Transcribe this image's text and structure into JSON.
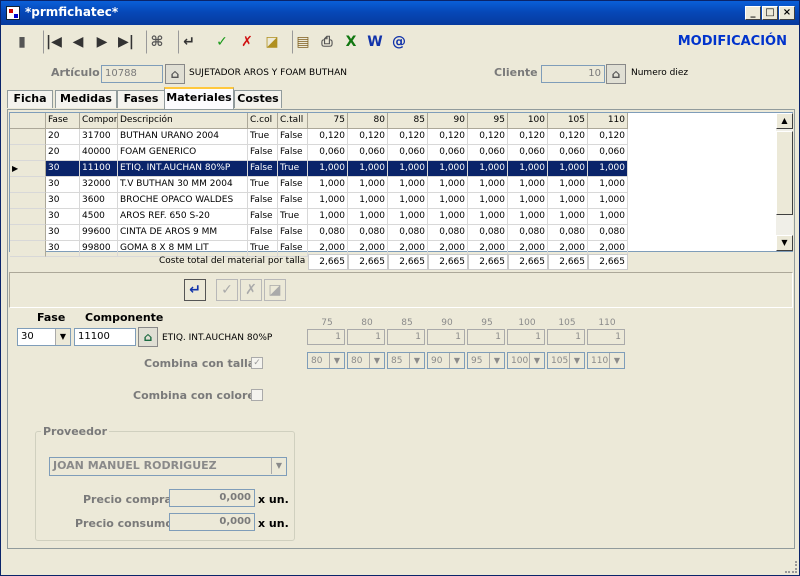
{
  "window": {
    "title": "*prmfichatec*"
  },
  "mode": "MODIFICACIÓN",
  "toolbar": {
    "icons": [
      "exit-icon",
      "first-icon",
      "prev-icon",
      "next-icon",
      "last-icon",
      "search-icon",
      "enter-icon",
      "accept-icon",
      "cancel-icon",
      "eraser-icon",
      "copy-icon",
      "print-icon",
      "excel-icon",
      "word-icon",
      "email-icon"
    ]
  },
  "header": {
    "articulo_label": "Artículo",
    "articulo_value": "10788",
    "articulo_desc": "SUJETADOR AROS Y FOAM BUTHAN",
    "cliente_label": "Cliente",
    "cliente_value": "10",
    "cliente_desc": "Numero diez"
  },
  "tabs": [
    "Ficha",
    "Medidas",
    "Fases",
    "Materiales",
    "Costes"
  ],
  "active_tab": "Materiales",
  "grid": {
    "columns": [
      "",
      "Fase",
      "Compon",
      "Descripción",
      "C.col",
      "C.tall",
      "75",
      "80",
      "85",
      "90",
      "95",
      "100",
      "105",
      "110"
    ],
    "rows": [
      {
        "sel": false,
        "fase": "20",
        "comp": "31700",
        "desc": "BUTHAN URANO 2004",
        "ccol": "True",
        "ctall": "False",
        "vals": [
          "0,120",
          "0,120",
          "0,120",
          "0,120",
          "0,120",
          "0,120",
          "0,120",
          "0,120"
        ]
      },
      {
        "sel": false,
        "fase": "20",
        "comp": "40000",
        "desc": "FOAM GENERICO",
        "ccol": "False",
        "ctall": "False",
        "vals": [
          "0,060",
          "0,060",
          "0,060",
          "0,060",
          "0,060",
          "0,060",
          "0,060",
          "0,060"
        ]
      },
      {
        "sel": true,
        "fase": "30",
        "comp": "11100",
        "desc": "ETIQ. INT.AUCHAN 80%P",
        "ccol": "False",
        "ctall": "True",
        "vals": [
          "1,000",
          "1,000",
          "1,000",
          "1,000",
          "1,000",
          "1,000",
          "1,000",
          "1,000"
        ]
      },
      {
        "sel": false,
        "fase": "30",
        "comp": "32000",
        "desc": "T.V BUTHAN 30 MM 2004",
        "ccol": "True",
        "ctall": "False",
        "vals": [
          "1,000",
          "1,000",
          "1,000",
          "1,000",
          "1,000",
          "1,000",
          "1,000",
          "1,000"
        ]
      },
      {
        "sel": false,
        "fase": "30",
        "comp": "3600",
        "desc": "BROCHE OPACO WALDES",
        "ccol": "False",
        "ctall": "False",
        "vals": [
          "1,000",
          "1,000",
          "1,000",
          "1,000",
          "1,000",
          "1,000",
          "1,000",
          "1,000"
        ]
      },
      {
        "sel": false,
        "fase": "30",
        "comp": "4500",
        "desc": "AROS REF. 650 S-20",
        "ccol": "False",
        "ctall": "True",
        "vals": [
          "1,000",
          "1,000",
          "1,000",
          "1,000",
          "1,000",
          "1,000",
          "1,000",
          "1,000"
        ]
      },
      {
        "sel": false,
        "fase": "30",
        "comp": "99600",
        "desc": "CINTA DE AROS 9 MM",
        "ccol": "False",
        "ctall": "False",
        "vals": [
          "0,080",
          "0,080",
          "0,080",
          "0,080",
          "0,080",
          "0,080",
          "0,080",
          "0,080"
        ]
      },
      {
        "sel": false,
        "fase": "30",
        "comp": "99800",
        "desc": "GOMA 8 X 8 MM LIT",
        "ccol": "True",
        "ctall": "False",
        "vals": [
          "2,000",
          "2,000",
          "2,000",
          "2,000",
          "2,000",
          "2,000",
          "2,000",
          "2,000"
        ]
      }
    ],
    "total_label": "Coste total del material por talla",
    "totals": [
      "2,665",
      "2,665",
      "2,665",
      "2,665",
      "2,665",
      "2,665",
      "2,665",
      "2,665"
    ]
  },
  "editor": {
    "fase_label": "Fase",
    "fase_value": "30",
    "componente_label": "Componente",
    "componente_value": "11100",
    "componente_desc": "ETIQ. INT.AUCHAN 80%P",
    "sizes": [
      "75",
      "80",
      "85",
      "90",
      "95",
      "100",
      "105",
      "110"
    ],
    "qty": [
      "1",
      "1",
      "1",
      "1",
      "1",
      "1",
      "1",
      "1"
    ],
    "size_combos": [
      "80",
      "80",
      "85",
      "90",
      "95",
      "100",
      "105",
      "110"
    ],
    "combina_tallas_label": "Combina con tallas",
    "combina_tallas_mark": "✓",
    "combina_colores_label": "Combina con colores"
  },
  "proveedor": {
    "label": "Proveedor",
    "value": "JOAN MANUEL RODRIGUEZ",
    "precio_compra_label": "Precio compra",
    "precio_compra": "0,000",
    "precio_consumo_label": "Precio consumo",
    "precio_consumo": "0,000",
    "unit": "x un."
  }
}
